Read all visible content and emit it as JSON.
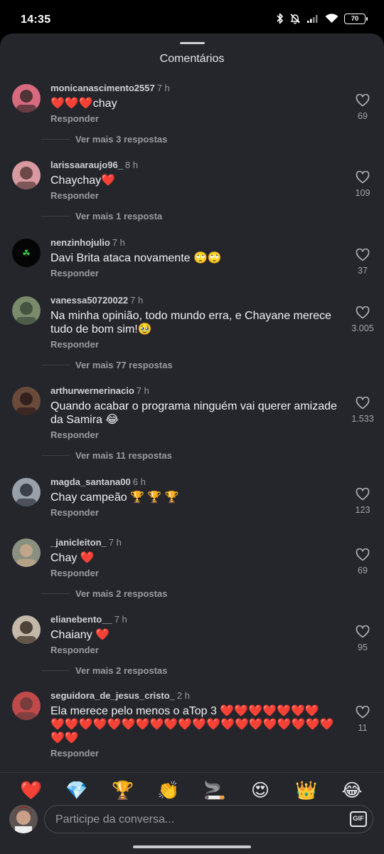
{
  "status_bar": {
    "time": "14:35",
    "battery": "70"
  },
  "sheet": {
    "title": "Comentários"
  },
  "reply_label": "Responder",
  "comments": [
    {
      "user": "monicanascimento2557",
      "time": "7 h",
      "lines": [
        "❤️❤️❤️chay"
      ],
      "likes": "69",
      "more_replies": "Ver mais 3 respostas"
    },
    {
      "user": "larissaaraujo96_",
      "time": "8 h",
      "lines": [
        "Chaychay❤️"
      ],
      "likes": "109",
      "more_replies": "Ver mais 1 resposta"
    },
    {
      "user": "nenzinhojulio",
      "time": "7 h",
      "lines": [
        "Davi Brita ataca novamente 🙄🙄"
      ],
      "likes": "37",
      "more_replies": ""
    },
    {
      "user": "vanessa50720022",
      "time": "7 h",
      "lines": [
        "Na minha opinião, todo mundo erra, e Chayane merece",
        "tudo de bom sim!🥹"
      ],
      "likes": "3.005",
      "more_replies": "Ver mais 77 respostas"
    },
    {
      "user": "arthurwernerinacio",
      "time": "7 h",
      "lines": [
        "Quando acabar o programa ninguém vai querer amizade",
        "da Samira 😂"
      ],
      "likes": "1.533",
      "more_replies": "Ver mais 11 respostas"
    },
    {
      "user": "magda_santana00",
      "time": "6 h",
      "lines": [
        "Chay campeão 🏆 🏆 🏆"
      ],
      "likes": "123",
      "more_replies": ""
    },
    {
      "user": "_janicleiton_",
      "time": "7 h",
      "lines": [
        "Chay ❤️"
      ],
      "likes": "69",
      "more_replies": "Ver mais 2 respostas"
    },
    {
      "user": "elianebento__",
      "time": "7 h",
      "lines": [
        "Chaiany ❤️"
      ],
      "likes": "95",
      "more_replies": "Ver mais 2 respostas"
    },
    {
      "user": "seguidora_de_jesus_cristo_",
      "time": "2 h",
      "lines": [
        "Ela merece pelo menos o aTop 3 ❤️❤️❤️❤️❤️❤️❤️",
        "❤️❤️❤️❤️❤️❤️❤️❤️❤️❤️❤️❤️❤️❤️❤️❤️❤️❤️❤️❤️",
        "❤️❤️"
      ],
      "likes": "11",
      "more_replies": ""
    }
  ],
  "quick_emojis": [
    "❤️",
    "💎",
    "🏆",
    "👏",
    "🚬",
    "😍",
    "👑",
    "😂"
  ],
  "composer": {
    "placeholder": "Participe da conversa...",
    "gif_label": "GIF"
  },
  "colors": {
    "background": "#24262b",
    "text": "#f1f1f3",
    "muted": "#9a9ba2"
  }
}
